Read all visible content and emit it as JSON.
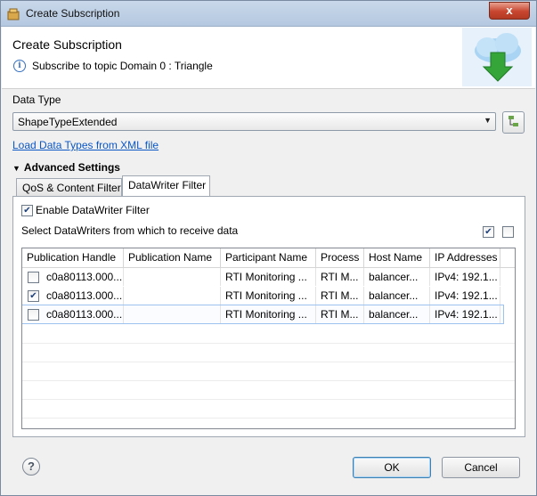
{
  "window": {
    "title": "Create Subscription",
    "close_label": "x"
  },
  "header": {
    "title": "Create Subscription",
    "subtitle": "Subscribe to topic Domain 0 : Triangle"
  },
  "data_type": {
    "label": "Data Type",
    "selected": "ShapeTypeExtended",
    "load_link": "Load Data Types from XML file"
  },
  "advanced": {
    "label": "Advanced Settings"
  },
  "tabs": [
    {
      "label": "QoS & Content Filter",
      "active": false
    },
    {
      "label": "DataWriter Filter",
      "active": true
    }
  ],
  "filter": {
    "enable_label": "Enable DataWriter Filter",
    "enable_checked": true,
    "select_label": "Select DataWriters from which to receive data"
  },
  "table": {
    "columns": [
      "Publication Handle",
      "Publication Name",
      "Participant Name",
      "Process",
      "Host Name",
      "IP Addresses"
    ],
    "rows": [
      {
        "checked": false,
        "cells": [
          "c0a80113.000...",
          "",
          "RTI Monitoring ...",
          "RTI M...",
          "balancer...",
          "IPv4: 192.1..."
        ]
      },
      {
        "checked": true,
        "cells": [
          "c0a80113.000...",
          "",
          "RTI Monitoring ...",
          "RTI M...",
          "balancer...",
          "IPv4: 192.1..."
        ]
      },
      {
        "checked": false,
        "cells": [
          "c0a80113.000...",
          "",
          "RTI Monitoring ...",
          "RTI M...",
          "balancer...",
          "IPv4: 192.1..."
        ]
      }
    ]
  },
  "buttons": {
    "ok": "OK",
    "cancel": "Cancel",
    "help": "?"
  }
}
